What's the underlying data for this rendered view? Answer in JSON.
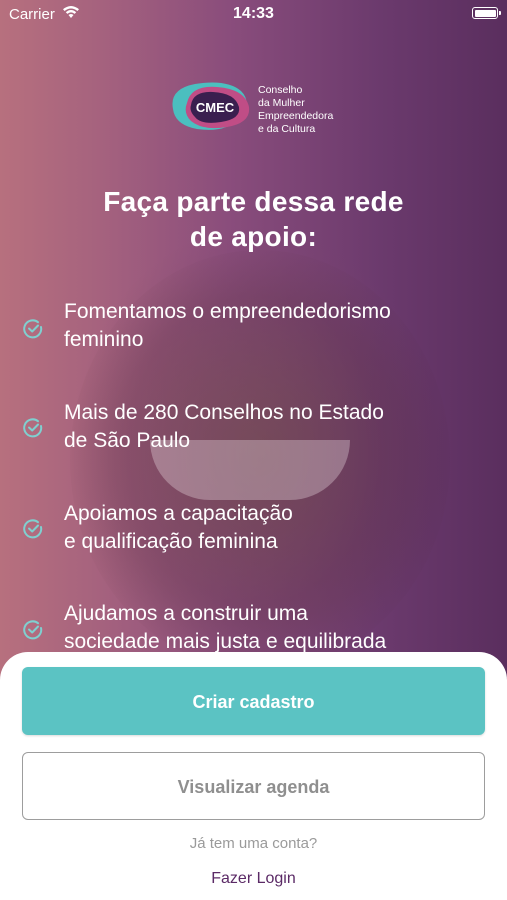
{
  "status_bar": {
    "carrier": "Carrier",
    "time": "14:33",
    "wifi_icon": "wifi-icon",
    "battery_icon": "battery-icon"
  },
  "logo": {
    "mark_text": "CMEC",
    "lines": [
      "Conselho",
      "da Mulher",
      "Empreendedora",
      "e da Cultura"
    ],
    "colors": {
      "teal": "#4bbfbf",
      "magenta": "#c04d86",
      "dark": "#3a1f4f"
    }
  },
  "headline": {
    "line1": "Faça parte dessa rede",
    "line2": "de apoio:"
  },
  "features": [
    {
      "icon": "check-circle-icon",
      "line1": "Fomentamos o empreendedorismo",
      "line2": "feminino"
    },
    {
      "icon": "check-circle-icon",
      "line1": "Mais de 280 Conselhos no Estado",
      "line2": "de São Paulo"
    },
    {
      "icon": "check-circle-icon",
      "line1": "Apoiamos a capacitação",
      "line2": "e qualificação feminina"
    },
    {
      "icon": "check-circle-icon",
      "line1": "Ajudamos a construir uma",
      "line2": "sociedade mais justa e equilibrada"
    }
  ],
  "actions": {
    "primary_label": "Criar cadastro",
    "secondary_label": "Visualizar agenda",
    "has_account": "Já tem uma conta?",
    "login_label": "Fazer Login"
  },
  "colors": {
    "accent_teal": "#5bc3c3",
    "login_purple": "#5b2a66",
    "check_teal": "#7fd0d0"
  }
}
